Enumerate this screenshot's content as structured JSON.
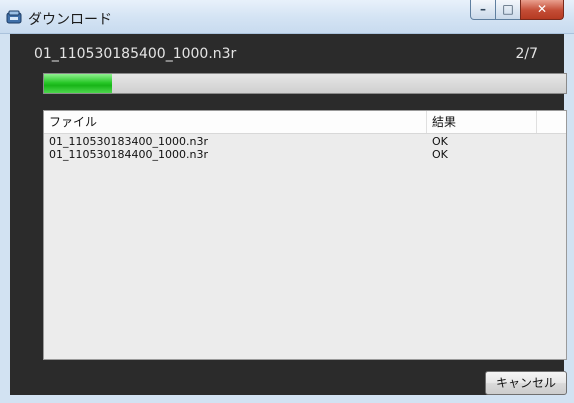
{
  "window": {
    "title": "ダウンロード",
    "icon": "download-app-icon"
  },
  "download": {
    "current_file": "01_110530185400_1000.n3r",
    "counter": "2/7",
    "progress_fraction": 0.13
  },
  "file_list": {
    "columns": [
      "ファイル",
      "結果"
    ],
    "rows": [
      {
        "file": "01_110530183400_1000.n3r",
        "result": "OK"
      },
      {
        "file": "01_110530184400_1000.n3r",
        "result": "OK"
      }
    ]
  },
  "buttons": {
    "cancel_label": "キャンセル"
  },
  "colors": {
    "progress_fill": "#1fbd1f",
    "close_button": "#c44d36"
  }
}
